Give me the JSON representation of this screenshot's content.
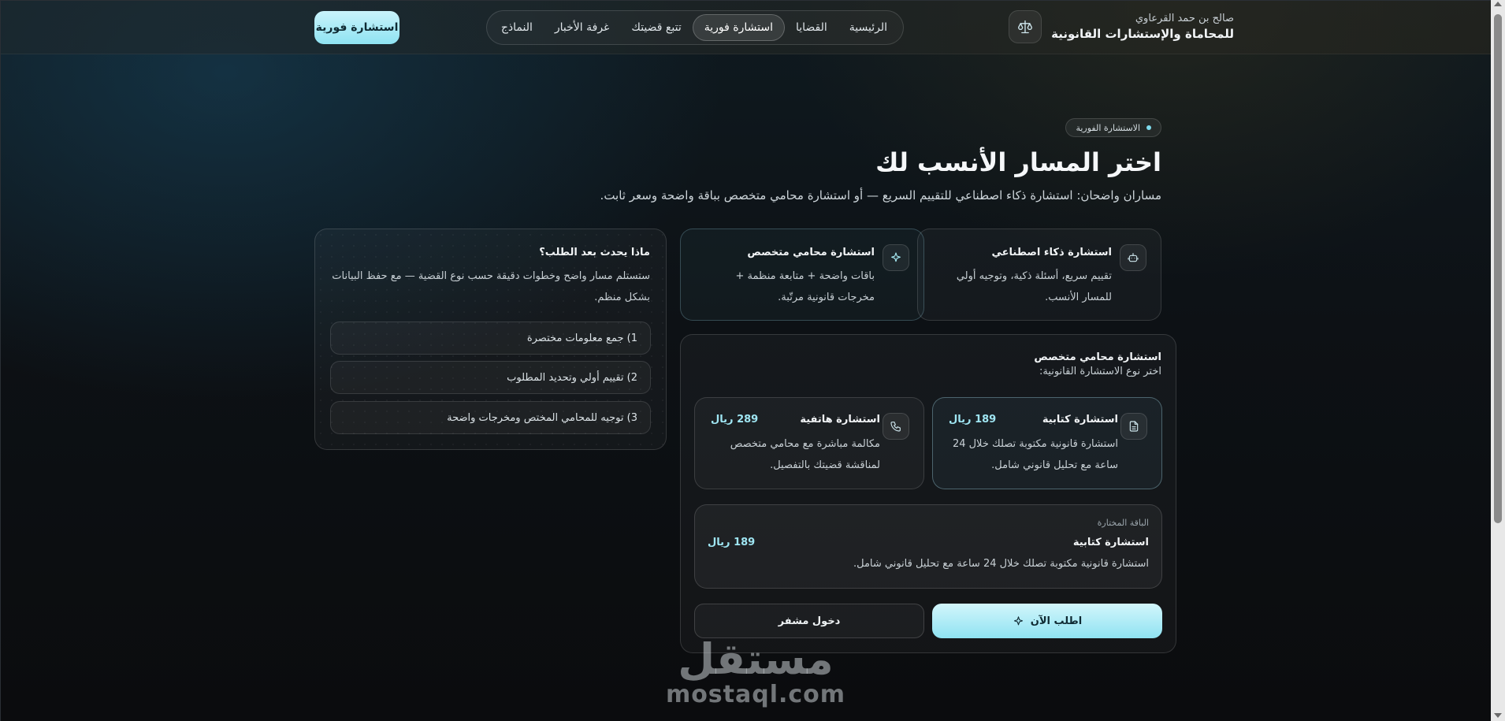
{
  "colors": {
    "accent": "#8fe3f2",
    "price": "#9fe6f3",
    "background": "#0d0f12"
  },
  "brand": {
    "subtitle": "صالح بن حمد القرعاوي",
    "title": "للمحاماة والإستشارات القانونية",
    "icon": "scales-icon"
  },
  "nav": {
    "items": [
      {
        "label": "الرئيسية",
        "active": false
      },
      {
        "label": "القضايا",
        "active": false
      },
      {
        "label": "استشارة فورية",
        "active": true
      },
      {
        "label": "تتبع قضيتك",
        "active": false
      },
      {
        "label": "غرفة الأخبار",
        "active": false
      },
      {
        "label": "النماذج",
        "active": false
      }
    ]
  },
  "header_cta": "استشارة فورية",
  "hero": {
    "pill": "الاستشارة الفورية",
    "title": "اختر المسار الأنسب لك",
    "subtitle": "مساران واضحان: استشارة ذكاء اصطناعي للتقييم السريع — أو استشارة محامي متخصص بباقة واضحة وسعر ثابت."
  },
  "paths": {
    "ai": {
      "title": "استشارة ذكاء اصطناعي",
      "desc": "تقييم سريع، أسئلة ذكية، وتوجيه أولي للمسار الأنسب.",
      "icon": "robot-icon"
    },
    "lawyer": {
      "title": "استشارة محامي متخصص",
      "desc": "باقات واضحة + متابعة منظمة + مخرجات قانونية مرتّبة.",
      "icon": "sparkle-icon"
    }
  },
  "after_request": {
    "title": "ماذا يحدث بعد الطلب؟",
    "desc": "ستستلم مسار واضح وخطوات دقيقة حسب نوع القضية — مع حفظ البيانات بشكل منظم.",
    "steps": [
      "1) جمع معلومات مختصرة",
      "2) تقييم أولي وتحديد المطلوب",
      "3) توجيه للمحامي المختص ومخرجات واضحة"
    ]
  },
  "panel": {
    "title": "استشارة محامي متخصص",
    "subtitle": "اختر نوع الاستشارة القانونية:",
    "options": [
      {
        "title": "استشارة كتابية",
        "price": "189 ريال",
        "desc": "استشارة قانونية مكتوبة تصلك خلال 24 ساعة مع تحليل قانوني شامل.",
        "icon": "document-icon"
      },
      {
        "title": "استشارة هاتفية",
        "price": "289 ريال",
        "desc": "مكالمة مباشرة مع محامي متخصص لمناقشة قضيتك بالتفصيل.",
        "icon": "phone-icon"
      }
    ],
    "selected": {
      "caption": "الباقة المختارة",
      "title": "استشارة كتابية",
      "price": "189 ريال",
      "desc": "استشارة قانونية مكتوبة تصلك خلال 24 ساعة مع تحليل قانوني شامل."
    },
    "primary_button": "اطلب الآن",
    "secondary_button": "دخول مشفر"
  },
  "watermark": {
    "ar": "مستقل",
    "en": "mostaql.com"
  }
}
